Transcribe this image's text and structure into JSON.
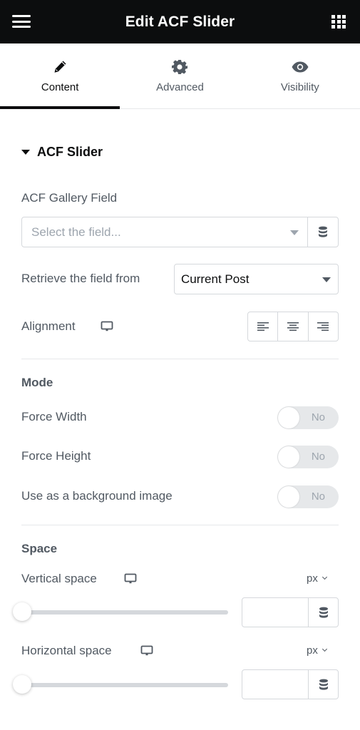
{
  "header": {
    "title": "Edit ACF Slider",
    "menu_icon": "hamburger-icon",
    "apps_icon": "grid-icon"
  },
  "tabs": [
    {
      "label": "Content",
      "icon": "pencil-icon",
      "active": true
    },
    {
      "label": "Advanced",
      "icon": "gear-icon",
      "active": false
    },
    {
      "label": "Visibility",
      "icon": "eye-icon",
      "active": false
    }
  ],
  "section": {
    "title": "ACF Slider",
    "gallery_field": {
      "label": "ACF Gallery Field",
      "placeholder": "Select the field..."
    },
    "retrieve": {
      "label": "Retrieve the field from",
      "value": "Current Post"
    },
    "alignment": {
      "label": "Alignment",
      "options": [
        "left",
        "center",
        "right"
      ]
    },
    "mode": {
      "heading": "Mode",
      "toggles": [
        {
          "label": "Force Width",
          "state": "No"
        },
        {
          "label": "Force Height",
          "state": "No"
        },
        {
          "label": "Use as a background image",
          "state": "No"
        }
      ]
    },
    "space": {
      "heading": "Space",
      "vertical": {
        "label": "Vertical space",
        "unit": "px",
        "value": "",
        "slider_fraction": 0
      },
      "horizontal": {
        "label": "Horizontal space",
        "unit": "px",
        "value": "",
        "slider_fraction": 0
      }
    }
  },
  "colors": {
    "header_bg": "#0c0d0e",
    "text": "#515962",
    "border": "#d5d8dc",
    "toggle_bg": "#e6e8ea"
  }
}
